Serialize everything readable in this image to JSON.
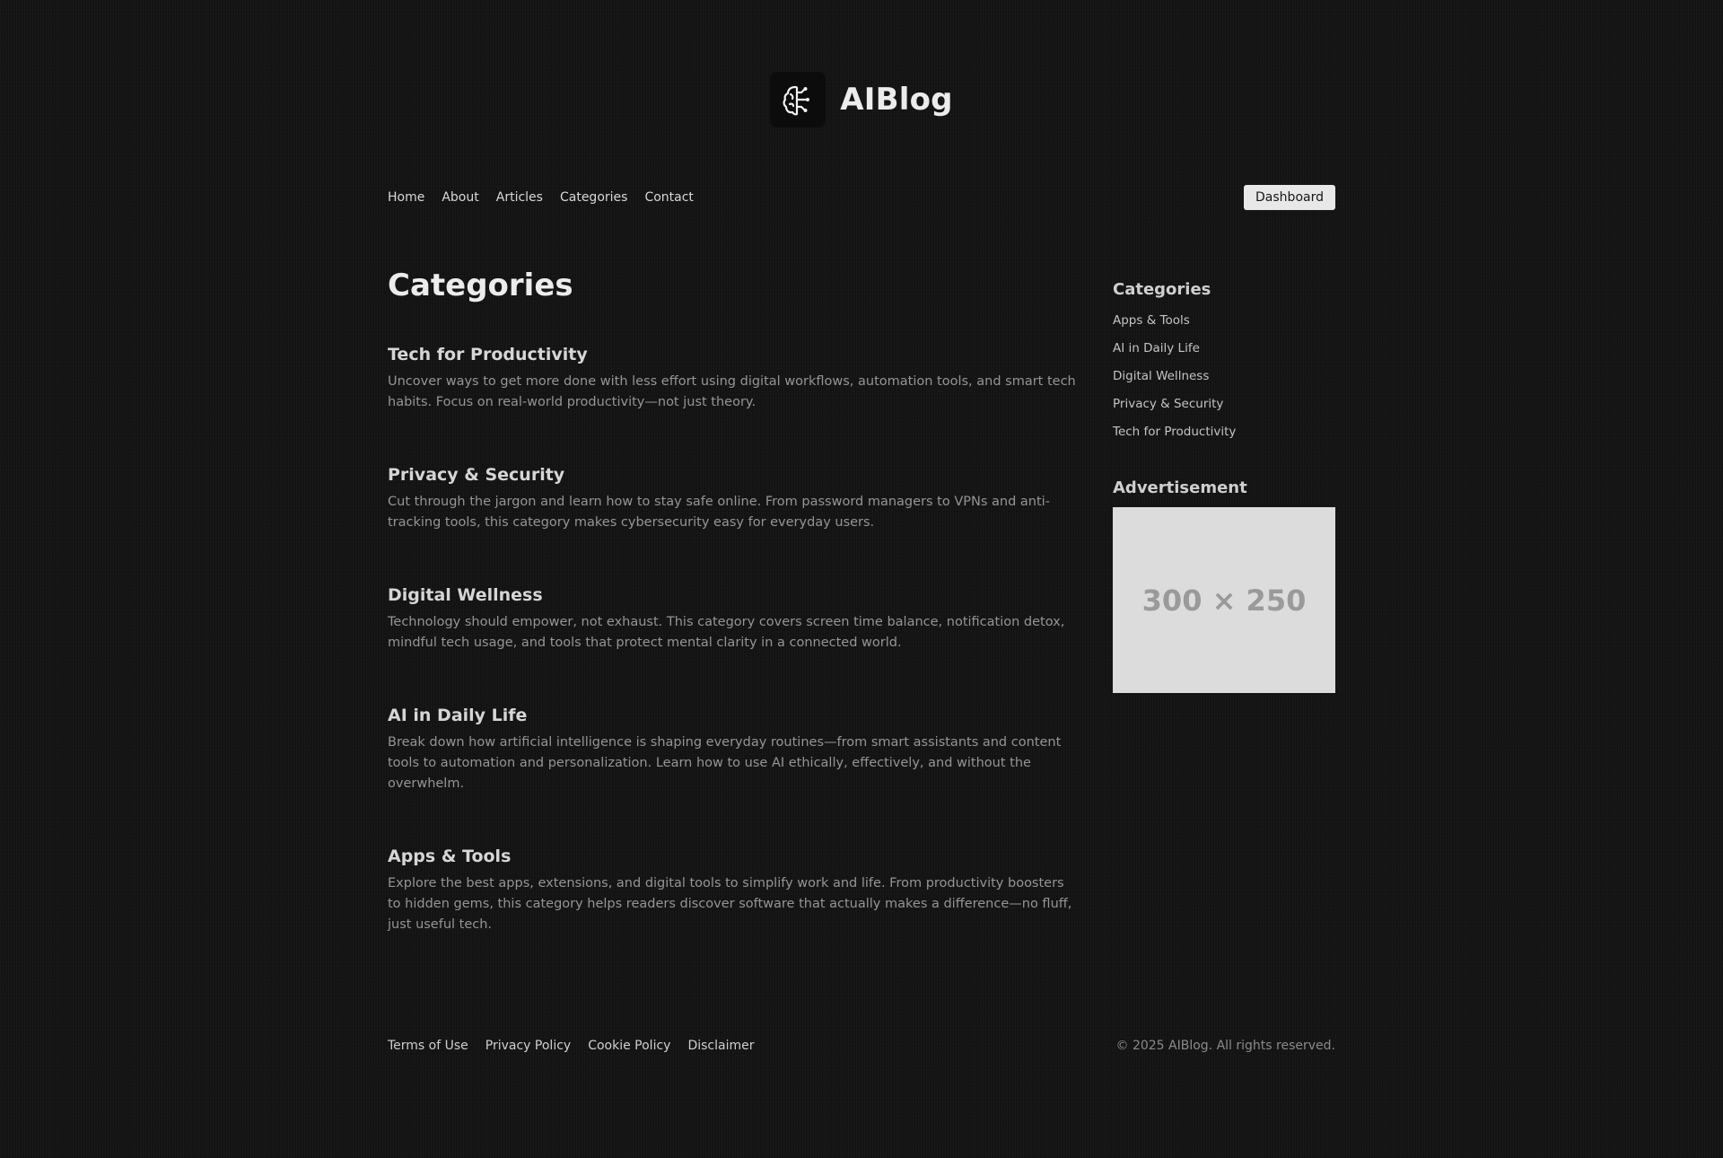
{
  "brand": {
    "name": "AIBlog",
    "logo_icon": "brain-icon"
  },
  "nav": {
    "links": [
      "Home",
      "About",
      "Articles",
      "Categories",
      "Contact"
    ],
    "dashboard_label": "Dashboard"
  },
  "main": {
    "title": "Categories",
    "categories": [
      {
        "title": "Tech for Productivity",
        "description": "Uncover ways to get more done with less effort using digital workflows, automation tools, and smart tech habits. Focus on real-world productivity—not just theory."
      },
      {
        "title": "Privacy & Security",
        "description": "Cut through the jargon and learn how to stay safe online. From password managers to VPNs and anti-tracking tools, this category makes cybersecurity easy for everyday users."
      },
      {
        "title": "Digital Wellness",
        "description": "Technology should empower, not exhaust. This category covers screen time balance, notification detox, mindful tech usage, and tools that protect mental clarity in a connected world."
      },
      {
        "title": "AI in Daily Life",
        "description": "Break down how artificial intelligence is shaping everyday routines—from smart assistants and content tools to automation and personalization. Learn how to use AI ethically, effectively, and without the overwhelm."
      },
      {
        "title": "Apps & Tools",
        "description": "Explore the best apps, extensions, and digital tools to simplify work and life. From productivity boosters to hidden gems, this category helps readers discover software that actually makes a difference—no fluff, just useful tech."
      }
    ]
  },
  "sidebar": {
    "categories_heading": "Categories",
    "categories": [
      "Apps & Tools",
      "AI in Daily Life",
      "Digital Wellness",
      "Privacy & Security",
      "Tech for Productivity"
    ],
    "ad_heading": "Advertisement",
    "ad_placeholder": "300 × 250"
  },
  "footer": {
    "links": [
      "Terms of Use",
      "Privacy Policy",
      "Cookie Policy",
      "Disclaimer"
    ],
    "copyright": "© 2025 AIBlog. All rights reserved."
  },
  "colors": {
    "background": "#141414",
    "text": "#e6e6e6",
    "muted": "#959595",
    "button_bg": "#e8e8e8",
    "ad_bg": "#dcdcdc"
  }
}
